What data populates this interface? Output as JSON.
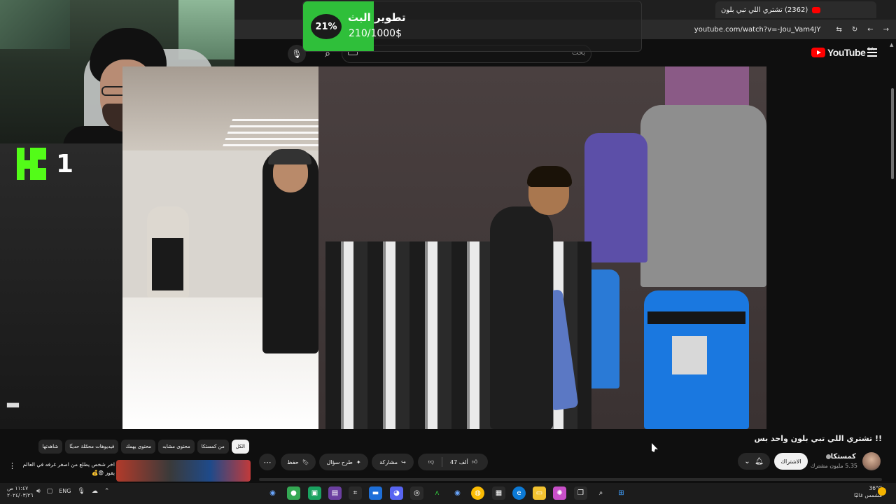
{
  "browser": {
    "tab_title": "(2362) تشتري اللي تبي بلون",
    "url": "youtube.com/watch?v=-Jou_Vam4JY"
  },
  "youtube": {
    "logo_text": "YouTube",
    "region": "SA",
    "search_placeholder": "بحث"
  },
  "stream_goal": {
    "title": "تطوير البث",
    "amount": "210/1000$",
    "percent_label": "21%",
    "progress": 0.21,
    "fill_color": "#2fbf3a"
  },
  "kick": {
    "count": "1",
    "color": "#53fc18"
  },
  "video": {
    "title": "!! تشتري اللي تبي بلون واحد بس"
  },
  "channel": {
    "name": "كمستكا",
    "subscribers": "5.35 مليون مشترك",
    "subscribe_label": "الاشتراك"
  },
  "actions": {
    "likes": "47 ألف",
    "share": "مشاركة",
    "ask": "طرح سؤال",
    "save": "حفظ",
    "more": "⋯"
  },
  "chips": [
    {
      "label": "الكل",
      "active": true
    },
    {
      "label": "من كمستكا",
      "active": false
    },
    {
      "label": "محتوى مشابه",
      "active": false
    },
    {
      "label": "محتوى يهمك",
      "active": false
    },
    {
      "label": "فيديوهات محمّلة حديثًا",
      "active": false
    },
    {
      "label": "شاهدتها",
      "active": false
    }
  ],
  "recommendation": {
    "title": "اخر شخص يطلع من اصغر غرفه في العالم يفوز 😨💰"
  },
  "taskbar": {
    "time": "١١:٤٧ ص",
    "date": "٢٠٢٤/٠٣/٢٦",
    "language": "ENG",
    "weather_temp": "36°C",
    "weather_desc": "مشمس غالبًا"
  }
}
